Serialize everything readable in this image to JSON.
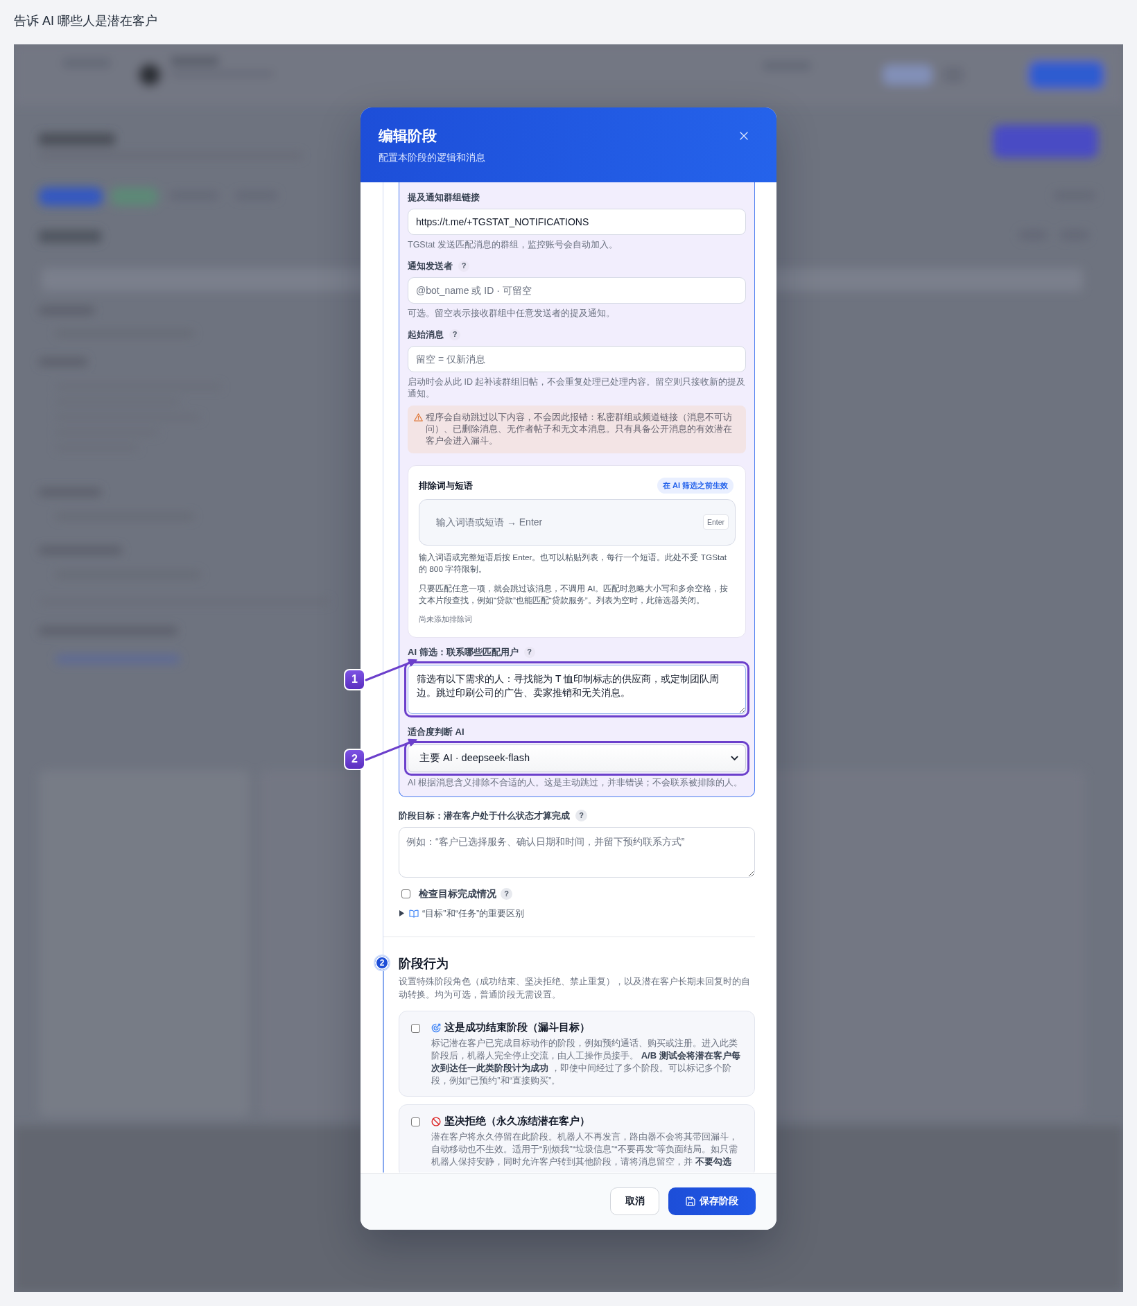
{
  "page": {
    "title": "告诉 AI 哪些人是潜在客户"
  },
  "dialog": {
    "title": "编辑阶段",
    "subtitle": "配置本阶段的逻辑和消息"
  },
  "filter_card": {
    "fields": [
      {
        "label": "提及通知群组链接",
        "value": "https://t.me/+TGSTAT_NOTIFICATIONS",
        "hint": "TGStat 发送匹配消息的群组，监控账号会自动加入。"
      },
      {
        "label": "通知发送者",
        "help": "?",
        "placeholder": "@bot_name 或 ID · 可留空",
        "hint": "可选。留空表示接收群组中任意发送者的提及通知。"
      },
      {
        "label": "起始消息",
        "help": "?",
        "placeholder": "留空 = 仅新消息",
        "hint": "启动时会从此 ID 起补读群组旧帖，不会重复处理已处理内容。留空则只接收新的提及通知。"
      }
    ],
    "warning": "程序会自动跳过以下内容，不会因此报错：私密群组或频道链接（消息不可访问）、已删除消息、无作者帖子和无文本消息。只有具备公开消息的有效潜在客户会进入漏斗。",
    "exclusions": {
      "title": "排除词与短语",
      "tag": "在 AI 筛选之前生效",
      "placeholder": "输入词语或短语 → Enter",
      "key_hint": "Enter",
      "notes": [
        "输入词语或完整短语后按 Enter。也可以粘贴列表，每行一个短语。此处不受 TGStat 的 800 字符限制。",
        "只要匹配任意一项，就会跳过该消息，不调用 AI。匹配时忽略大小写和多余空格，按文本片段查找，例如“贷款”也能匹配“贷款服务”。列表为空时，此筛选器关闭。"
      ],
      "empty_text": "尚未添加排除词"
    },
    "ai_filter": {
      "label": "AI 筛选：联系哪些匹配用户",
      "help": "?",
      "value": "筛选有以下需求的人：寻找能为 T 恤印制标志的供应商，或定制团队周边。跳过印刷公司的广告、卖家推销和无关消息。",
      "annotation": "1"
    },
    "model": {
      "label": "适合度判断 AI",
      "value": "主要 AI · deepseek-flash",
      "annotation": "2",
      "hint": "AI 根据消息含义排除不合适的人。这是主动跳过，并非错误；不会联系被排除的人。"
    }
  },
  "goal": {
    "label": "阶段目标：潜在客户处于什么状态才算完成",
    "help": "?",
    "placeholder": "例如：“客户已选择服务、确认日期和时间，并留下预约联系方式”",
    "check": {
      "label": "检查目标完成情况",
      "checked": false,
      "help": "?"
    },
    "disclosure": {
      "label": "“目标”和“任务”的重要区别",
      "expanded": false
    }
  },
  "behavior": {
    "number": "2",
    "title": "阶段行为",
    "description": "设置特殊阶段角色（成功结束、坚决拒绝、禁止重复），以及潜在客户长期未回复时的自动转换。均为可选，普通阶段无需设置。",
    "options": [
      {
        "kind": "success",
        "checked": false,
        "title": "这是成功结束阶段（漏斗目标）",
        "description": "标记潜在客户已完成目标动作的阶段，例如预约通话、购买或注册。进入此类阶段后，机器人完全停止交流，由人工操作员接手。 **A/B 测试会将潜在客户每次到达任一此类阶段计为成功** ，即使中间经过了多个阶段。可以标记多个阶段，例如“已预约”和“直接购买”。"
      },
      {
        "kind": "reject",
        "checked": false,
        "title": "坚决拒绝（永久冻结潜在客户）",
        "description": "潜在客户将永久停留在此阶段。机器人不再发言，路由器不会将其带回漏斗，自动移动也不生效。适用于“别烦我”“垃圾信息”“不要再发”等负面结局。如只需机器人保持安静，同时允许客户转到其他阶段，请将消息留空，并 **不要勾选**"
      }
    ]
  },
  "footer": {
    "buttons": [
      {
        "kind": "secondary",
        "label": "取消"
      },
      {
        "kind": "primary",
        "label": "保存阶段"
      }
    ]
  }
}
